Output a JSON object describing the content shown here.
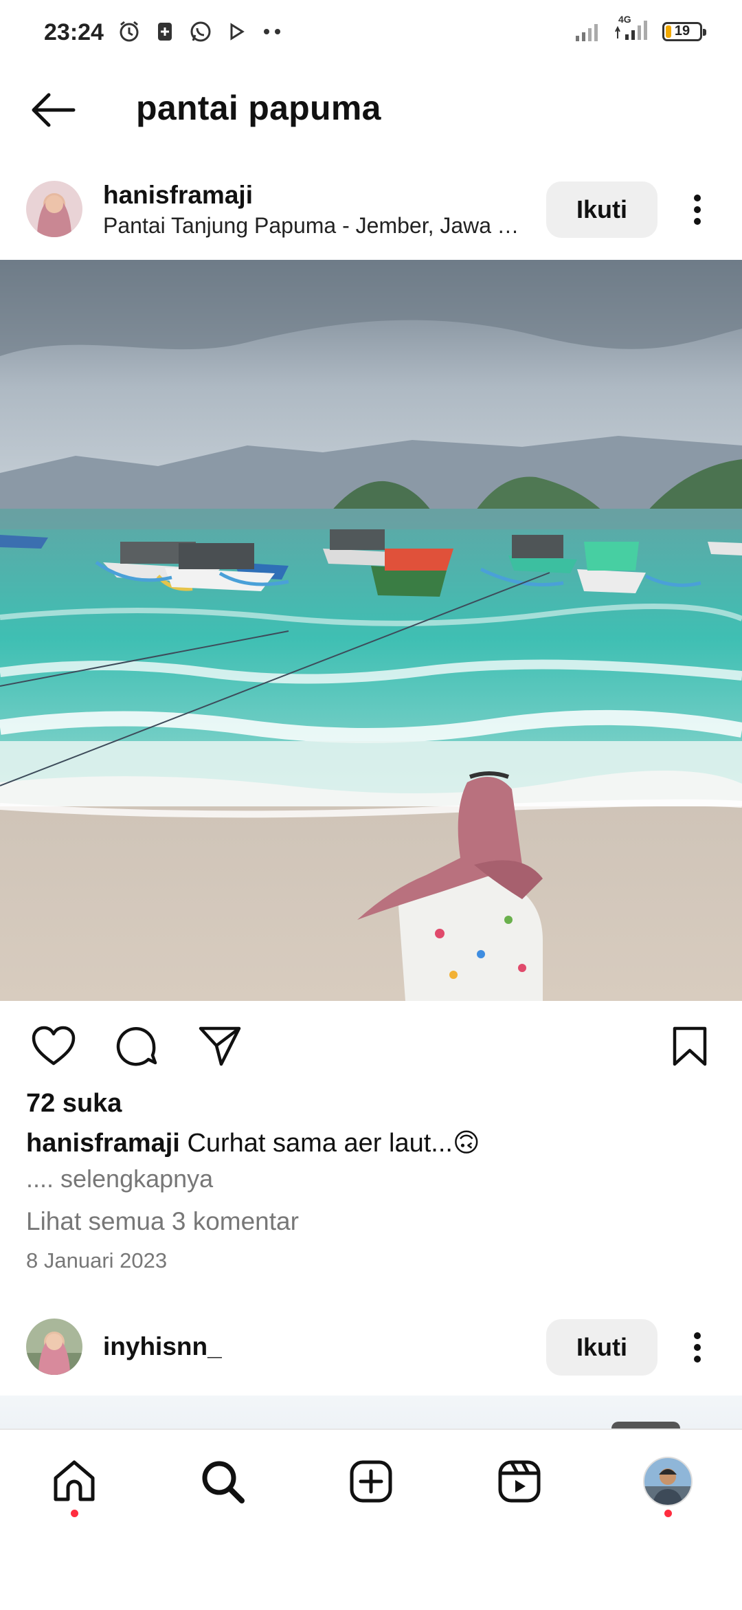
{
  "status_bar": {
    "time": "23:24",
    "left_icons": [
      "alarm-icon",
      "notification-icon",
      "whatsapp-icon",
      "play-icon",
      "more-dots-icon"
    ],
    "network": "4G",
    "battery": "19",
    "battery_color": "#f2a900"
  },
  "header": {
    "back_icon": "arrow-left-icon",
    "title": "pantai papuma"
  },
  "post": {
    "username": "hanisframaji",
    "location": "Pantai Tanjung Papuma - Jember, Jawa Timur",
    "follow_label": "Ikuti",
    "likes": "72 suka",
    "caption_user": "hanisframaji",
    "caption_text": "Curhat sama aer laut...🙃",
    "more_label": ".... selengkapnya",
    "comments_link": "Lihat semua 3 komentar",
    "date": "8 Januari 2023",
    "actions": [
      "heart-icon",
      "comment-icon",
      "share-icon",
      "bookmark-icon"
    ]
  },
  "next_post": {
    "username": "inyhisnn_",
    "follow_label": "Ikuti"
  },
  "bottom_nav": {
    "items": [
      "home-icon",
      "search-icon",
      "create-icon",
      "reels-icon",
      "profile-avatar"
    ],
    "notification_dot_color": "#ff2d3f"
  }
}
